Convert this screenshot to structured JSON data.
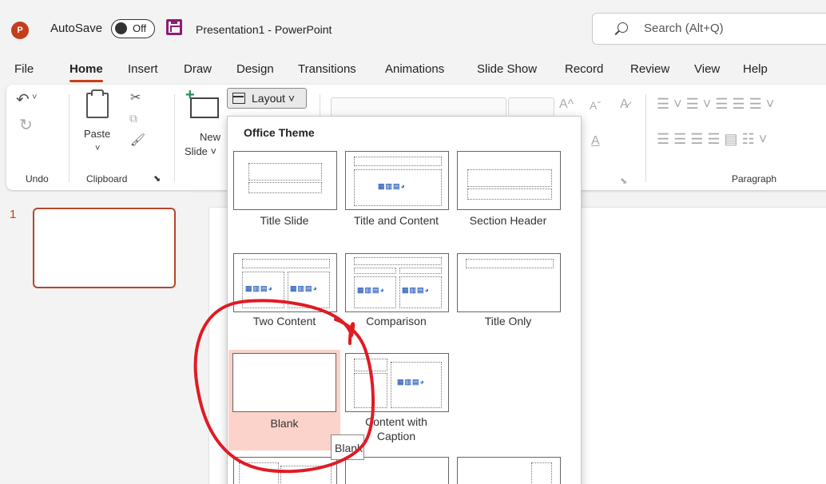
{
  "titlebar": {
    "app_icon": "P",
    "autosave_label": "AutoSave",
    "autosave_state": "Off",
    "save_icon": "floppy-disk-icon",
    "doc_title": "Presentation1 - PowerPoint",
    "search_placeholder": "Search (Alt+Q)"
  },
  "menu": {
    "tabs": [
      "File",
      "Home",
      "Insert",
      "Draw",
      "Design",
      "Transitions",
      "Animations",
      "Slide Show",
      "Record",
      "Review",
      "View",
      "Help"
    ],
    "active": "Home"
  },
  "ribbon": {
    "undo_label": "Undo",
    "paste_label": "Paste",
    "clipboard_label": "Clipboard",
    "new_slide_line1": "New",
    "new_slide_line2": "Slide ˅",
    "layout_label": "Layout ˅",
    "paragraph_label": "Paragraph"
  },
  "slides_panel": {
    "slide_number": "1"
  },
  "layout_menu": {
    "header": "Office Theme",
    "items": [
      {
        "label": "Title Slide"
      },
      {
        "label": "Title and Content"
      },
      {
        "label": "Section Header"
      },
      {
        "label": "Two Content"
      },
      {
        "label": "Comparison"
      },
      {
        "label": "Title Only"
      },
      {
        "label": "Blank"
      },
      {
        "label_line1": "Content with",
        "label_line2": "Caption"
      }
    ],
    "tooltip": "Blank"
  },
  "colors": {
    "accent": "#c43e1c",
    "annotation": "#e01b24",
    "hover": "#fbd3cb"
  }
}
